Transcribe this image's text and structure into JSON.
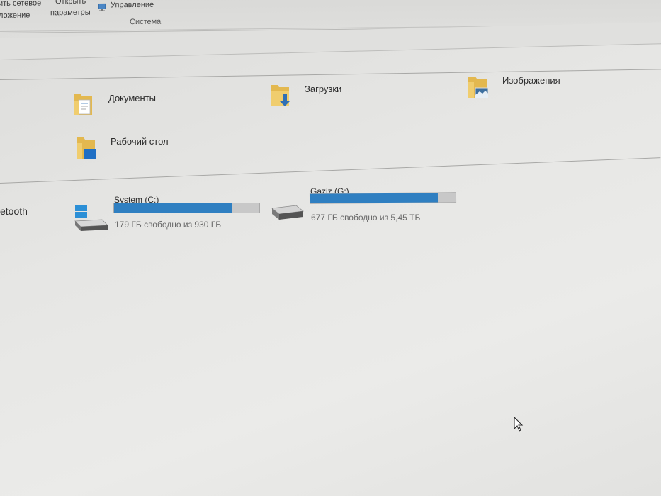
{
  "ribbon": {
    "network_button_line1": "ить сетевое",
    "network_button_line2": "ложение",
    "open_params_line1": "Открыть",
    "open_params_line2": "параметры",
    "manage_label": "Управление",
    "group_label": "Система"
  },
  "nav": {
    "bluetooth_label": "etooth"
  },
  "folders": [
    {
      "name": "Документы",
      "icon": "documents-folder-icon"
    },
    {
      "name": "Загрузки",
      "icon": "downloads-folder-icon"
    },
    {
      "name": "Изображения",
      "icon": "pictures-folder-icon"
    },
    {
      "name": "Рабочий стол",
      "icon": "desktop-folder-icon"
    }
  ],
  "drives": [
    {
      "name": "System (C:)",
      "free_text": "179 ГБ свободно из 930 ГБ",
      "used_fraction": 0.81,
      "icon": "system-drive-icon"
    },
    {
      "name": "Gaziz (G:)",
      "free_text": "677 ГБ свободно из 5,45 ТБ",
      "used_fraction": 0.88,
      "icon": "hard-drive-icon"
    }
  ],
  "colors": {
    "bar_fill": "#2f7fc1",
    "bar_bg": "#c8c8c8",
    "folder_yellow": "#e8c25a"
  }
}
